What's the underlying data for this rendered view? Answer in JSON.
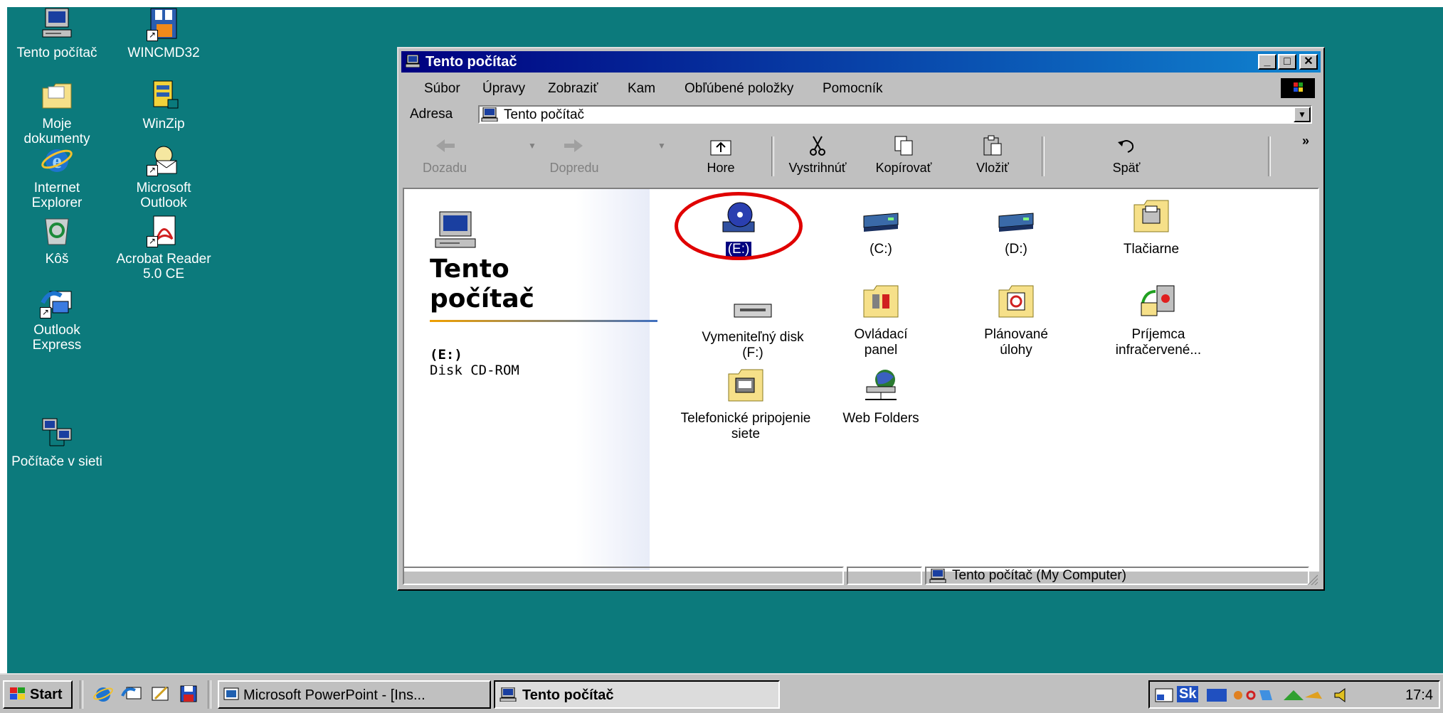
{
  "desktop": {
    "icons": [
      {
        "label": "Tento počítač",
        "icon": "my-computer-icon"
      },
      {
        "label": "WINCMD32",
        "icon": "wincmd-icon"
      },
      {
        "label": "Moje dokumenty",
        "icon": "folder-documents-icon"
      },
      {
        "label": "WinZip",
        "icon": "winzip-icon"
      },
      {
        "label": "Internet Explorer",
        "icon": "ie-icon"
      },
      {
        "label": "Microsoft Outlook",
        "icon": "outlook-icon"
      },
      {
        "label": "Kôš",
        "icon": "recycle-bin-icon"
      },
      {
        "label": "Acrobat Reader 5.0 CE",
        "icon": "acrobat-icon"
      },
      {
        "label": "Outlook Express",
        "icon": "outlook-express-icon"
      },
      {
        "label": "Počítače v sieti",
        "icon": "network-icon"
      }
    ]
  },
  "window": {
    "title": "Tento počítač",
    "menu": [
      "Súbor",
      "Úpravy",
      "Zobraziť",
      "Kam",
      "Obľúbené položky",
      "Pomocník"
    ],
    "address_label": "Adresa",
    "address_value": "Tento počítač",
    "toolbar": {
      "back": "Dozadu",
      "forward": "Dopredu",
      "up": "Hore",
      "cut": "Vystrihnúť",
      "copy": "Kopírovať",
      "paste": "Vložiť",
      "undo": "Späť",
      "more": "»"
    },
    "left_pane": {
      "title_line1": "Tento",
      "title_line2": "počítač",
      "selected_name": "(E:)",
      "selected_type": "Disk CD-ROM"
    },
    "items": {
      "e": "(E:)",
      "c": "(C:)",
      "d": "(D:)",
      "printers": "Tlačiarne",
      "removable": "Vymeniteľný disk (F:)",
      "control": "Ovládací panel",
      "tasks": "Plánované úlohy",
      "infrared": "Príjemca infračervené...",
      "dialup": "Telefonické pripojenie siete",
      "webfolders": "Web Folders"
    },
    "status": "Tento počítač (My Computer)",
    "highlight_color": "#e00000"
  },
  "taskbar": {
    "start": "Start",
    "tasks": [
      "Microsoft PowerPoint - [Ins...",
      "Tento počítač"
    ],
    "clock": "17:4",
    "tray_text": "Sk"
  }
}
